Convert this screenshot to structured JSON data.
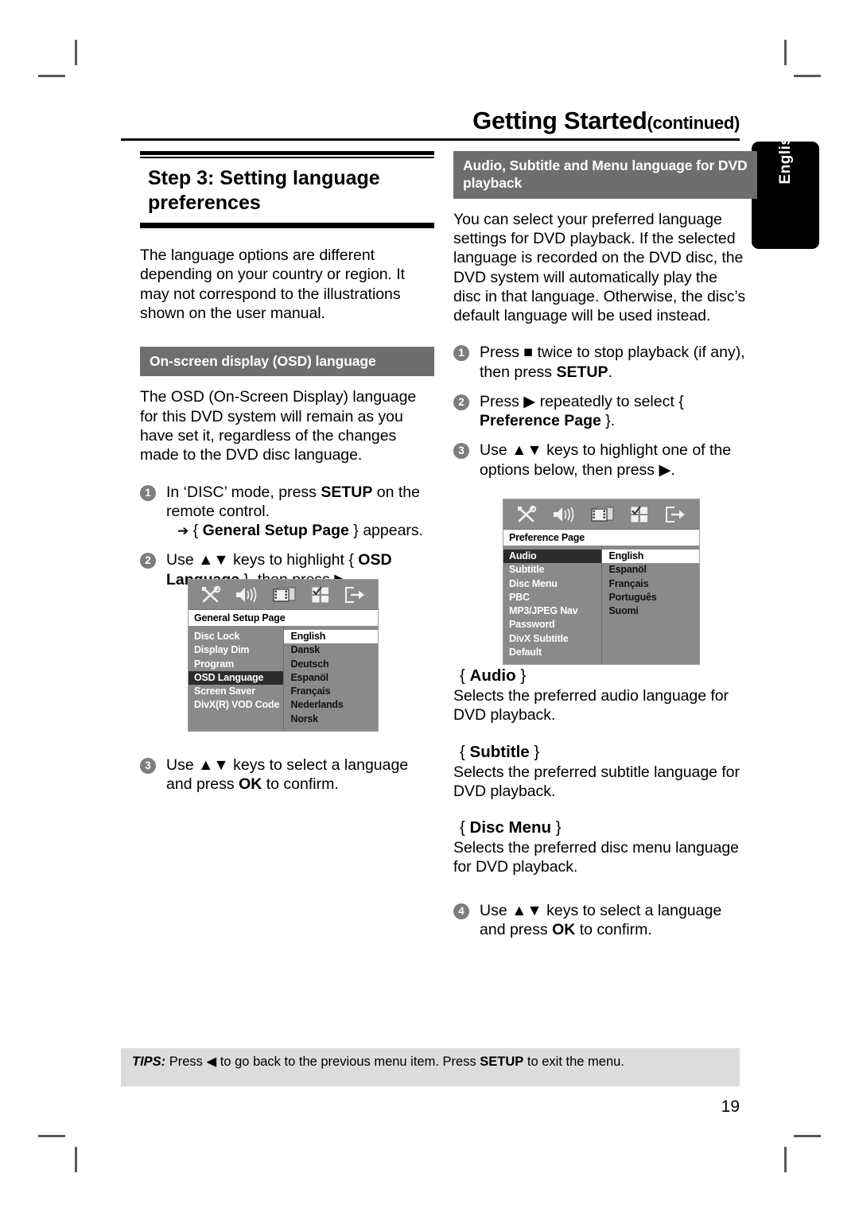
{
  "header": {
    "title": "Getting Started",
    "continued": "(continued)"
  },
  "side_tab": {
    "label": "English"
  },
  "left_column": {
    "step3_heading": "Step 3:  Setting language preferences",
    "intro": "The language options are different depending on your country or region.  It may not correspond to the illustrations shown on the user manual.",
    "osd_band": "On-screen display (OSD) language",
    "osd_paragraph": "The OSD (On-Screen Display) language for this DVD system will remain as you have set it, regardless of the changes made to the DVD disc language.",
    "steps": [
      {
        "num": "1",
        "pre": "In ‘DISC’ mode, press ",
        "bold": "SETUP",
        "post": " on the remote control.",
        "sub_arrow": "➔",
        "sub_pre": " { ",
        "sub_bold": "General Setup Page",
        "sub_post": " } appears."
      },
      {
        "num": "2",
        "pre": "Use ▲▼ keys to highlight { ",
        "bold": "OSD Language",
        "post": " }, then press ▶."
      },
      {
        "num": "3",
        "pre": "Use ▲▼ keys to select a language and press ",
        "bold": "OK",
        "post": " to confirm."
      }
    ]
  },
  "right_column": {
    "band": "Audio, Subtitle and Menu language for DVD playback",
    "paragraph": "You can select your preferred language settings for DVD playback.  If the selected language is recorded on the DVD disc, the DVD system will automatically play the disc in that language.  Otherwise, the disc’s default language will be used instead.",
    "steps": [
      {
        "num": "1",
        "pre": "Press ■ twice to stop playback (if any), then press ",
        "bold": "SETUP",
        "post": "."
      },
      {
        "num": "2",
        "pre": "Press ▶ repeatedly to select { ",
        "bold": "Preference Page",
        "post": " }."
      },
      {
        "num": "3",
        "pre": "Use ▲▼ keys to highlight one of the options below, then press ▶.",
        "bold": "",
        "post": ""
      }
    ],
    "definitions": [
      {
        "open": "{ ",
        "name": "Audio",
        "close": " }",
        "text": "Selects the preferred audio language for DVD playback."
      },
      {
        "open": "{ ",
        "name": "Subtitle",
        "close": " }",
        "text": "Selects the preferred subtitle language for DVD playback."
      },
      {
        "open": "{ ",
        "name": "Disc Menu",
        "close": " }",
        "text": "Selects the preferred disc menu language for DVD playback."
      }
    ],
    "final_step": {
      "num": "4",
      "pre": "Use ▲▼ keys to select a language and press ",
      "bold": "OK",
      "post": " to confirm."
    }
  },
  "osd_general": {
    "title": "General Setup Page",
    "icons": [
      "general-setup-icon",
      "audio-setup-icon",
      "video-setup-icon",
      "preference-setup-icon",
      "exit-setup-icon"
    ],
    "menu_items": [
      "Disc Lock",
      "Display Dim",
      "Program",
      "OSD Language",
      "Screen Saver",
      "DivX(R) VOD Code"
    ],
    "selected_menu_item": "OSD Language",
    "options": [
      "English",
      "Dansk",
      "Deutsch",
      "Espanöl",
      "Français",
      "Nederlands",
      "Norsk"
    ],
    "selected_option": "English"
  },
  "osd_preference": {
    "title": "Preference Page",
    "icons": [
      "general-setup-icon",
      "audio-setup-icon",
      "video-setup-icon",
      "preference-setup-icon",
      "exit-setup-icon"
    ],
    "menu_items": [
      "Audio",
      "Subtitle",
      "Disc Menu",
      "PBC",
      "MP3/JPEG Nav",
      "Password",
      "DivX Subtitle",
      "Default"
    ],
    "selected_menu_item": "Audio",
    "options": [
      "English",
      "Espanöl",
      "Français",
      "Português",
      "Suomi"
    ],
    "selected_option": "English"
  },
  "tips": {
    "label": "TIPS:",
    "pre": "  Press ◀ to go back to the previous menu item.  Press ",
    "bold": "SETUP",
    "post": " to exit the menu."
  },
  "page_number": "19",
  "colors": {
    "band_gray": "#6e6e6e",
    "osd_gray": "#8a8a8a",
    "osd_selected": "#2c2c2c",
    "tips_gray": "#dcdcdc",
    "step_bullet": "#7d7d7d"
  }
}
